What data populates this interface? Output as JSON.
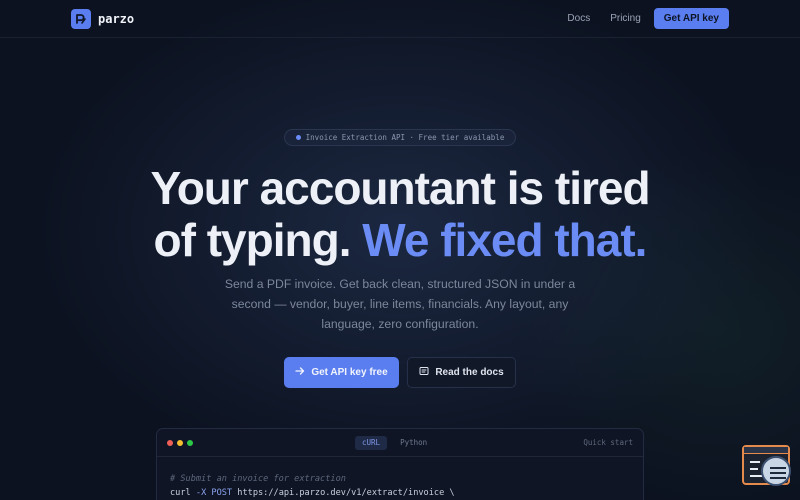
{
  "nav": {
    "brand": "parzo",
    "links": [
      "Docs",
      "Pricing"
    ],
    "cta": "Get API key"
  },
  "hero": {
    "badge": "Invoice Extraction API · Free tier available",
    "headline_line1": "Your accountant is tired",
    "headline_line2_plain": "of typing. ",
    "headline_line2_accent": "We fixed that.",
    "subtext": "Send a PDF invoice. Get back clean, structured JSON in under a second — vendor, buyer, line items, financials. Any layout, any language, zero configuration.",
    "primary_button": "Get API key free",
    "secondary_button": "Read the docs"
  },
  "code_panel": {
    "tabs": [
      {
        "label": "cURL",
        "active": true
      },
      {
        "label": "Python",
        "active": false
      }
    ],
    "quick_start": "Quick start",
    "comment": "# Submit an invoice for extraction",
    "cmd": "curl",
    "flag": "-X POST",
    "url": "https://api.parzo.dev/v1/extract/invoice \\"
  },
  "colors": {
    "accent": "#5a7ef0",
    "accent_text": "#6a8cf4",
    "background": "#0c1220",
    "dot_red": "#ef5f57",
    "dot_yellow": "#f5be30",
    "dot_green": "#2ec848",
    "widget_border": "#e38a4c"
  },
  "icons": {
    "logo": "parzo-logo-icon",
    "primary_button": "arrow-right-icon",
    "secondary_button": "docs-icon",
    "widget": "terminal-window-icon"
  }
}
